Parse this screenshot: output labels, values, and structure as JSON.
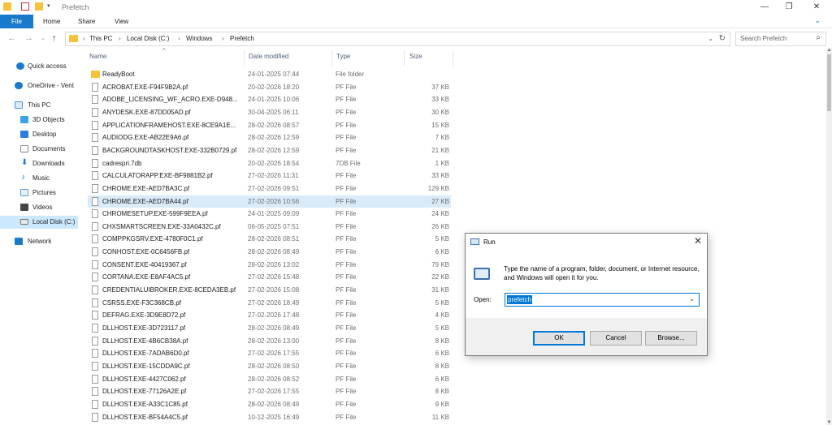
{
  "window": {
    "title": "Prefetch",
    "minimize_glyph": "—",
    "restore_glyph": "❐",
    "close_glyph": "✕"
  },
  "ribbon": {
    "tabs": [
      "File",
      "Home",
      "Share",
      "View"
    ]
  },
  "address": {
    "breadcrumbs": [
      "This PC",
      "Local Disk (C:)",
      "Windows",
      "Prefetch"
    ],
    "separator": "›"
  },
  "search": {
    "placeholder": "Search Prefetch"
  },
  "navpane": {
    "items": [
      {
        "label": "Quick access",
        "icon": "star-icon",
        "color": "#1979ca"
      },
      {
        "label": "OneDrive - Vent",
        "icon": "cloud-icon",
        "color": "#1979ca"
      },
      {
        "label": "This PC",
        "icon": "computer-icon",
        "color": "#4a90d9"
      },
      {
        "label": "3D Objects",
        "icon": "cube-icon",
        "color": "#3aa3e3"
      },
      {
        "label": "Desktop",
        "icon": "desktop-icon",
        "color": "#2b7de0"
      },
      {
        "label": "Documents",
        "icon": "documents-icon",
        "color": "#8a8a8a"
      },
      {
        "label": "Downloads",
        "icon": "download-icon",
        "color": "#1979ca"
      },
      {
        "label": "Music",
        "icon": "music-icon",
        "color": "#1979ca"
      },
      {
        "label": "Pictures",
        "icon": "pictures-icon",
        "color": "#5c9bd6"
      },
      {
        "label": "Videos",
        "icon": "videos-icon",
        "color": "#444444"
      },
      {
        "label": "Local Disk (C:)",
        "icon": "drive-icon",
        "color": "#777777"
      },
      {
        "label": "Network",
        "icon": "network-icon",
        "color": "#1979ca"
      }
    ]
  },
  "columns": {
    "name": "Name",
    "date": "Date modified",
    "type": "Type",
    "size": "Size"
  },
  "files": [
    {
      "name": "ReadyBoot",
      "date": "24-01-2025 07:44",
      "type": "File folder",
      "size": "",
      "folder": true
    },
    {
      "name": "ACROBAT.EXE-F94F9B2A.pf",
      "date": "20-02-2026 18:20",
      "type": "PF File",
      "size": "37 KB"
    },
    {
      "name": "ADOBE_LICENSING_WF_ACRO.EXE-D948...",
      "date": "24-01-2025 10:06",
      "type": "PF File",
      "size": "33 KB"
    },
    {
      "name": "ANYDESK.EXE-87DD05AD.pf",
      "date": "30-04-2025 06:11",
      "type": "PF File",
      "size": "30 KB"
    },
    {
      "name": "APPLICATIONFRAMEHOST.EXE-8CE9A1E...",
      "date": "28-02-2026 08:57",
      "type": "PF File",
      "size": "15 KB"
    },
    {
      "name": "AUDIODG.EXE-AB22E9A6.pf",
      "date": "28-02-2026 12:59",
      "type": "PF File",
      "size": "7 KB"
    },
    {
      "name": "BACKGROUNDTASKHOST.EXE-332B0729.pf",
      "date": "28-02-2026 12:59",
      "type": "PF File",
      "size": "21 KB"
    },
    {
      "name": "cadrespri.7db",
      "date": "20-02-2026 18:54",
      "type": "7DB File",
      "size": "1 KB"
    },
    {
      "name": "CALCULATORAPP.EXE-BF9881B2.pf",
      "date": "27-02-2026 11:31",
      "type": "PF File",
      "size": "33 KB"
    },
    {
      "name": "CHROME.EXE-AED7BA3C.pf",
      "date": "27-02-2026 09:51",
      "type": "PF File",
      "size": "129 KB"
    },
    {
      "name": "CHROME.EXE-AED7BA44.pf",
      "date": "27-02-2026 10:56",
      "type": "PF File",
      "size": "27 KB",
      "selected": true
    },
    {
      "name": "CHROMESETUP.EXE-599F9EEA.pf",
      "date": "24-01-2025 09:09",
      "type": "PF File",
      "size": "24 KB"
    },
    {
      "name": "CHXSMARTSCREEN.EXE-33A0432C.pf",
      "date": "06-05-2025 07:51",
      "type": "PF File",
      "size": "26 KB"
    },
    {
      "name": "COMPPKGSRV.EXE-4780F0C1.pf",
      "date": "28-02-2026 08:51",
      "type": "PF File",
      "size": "5 KB"
    },
    {
      "name": "CONHOST.EXE-0C6456FB.pf",
      "date": "28-02-2026 08:49",
      "type": "PF File",
      "size": "6 KB"
    },
    {
      "name": "CONSENT.EXE-40419367.pf",
      "date": "28-02-2026 13:02",
      "type": "PF File",
      "size": "79 KB"
    },
    {
      "name": "CORTANA.EXE-E8AF4AC5.pf",
      "date": "27-02-2026 15:48",
      "type": "PF File",
      "size": "22 KB"
    },
    {
      "name": "CREDENTIALUIBROKER.EXE-8CEDA3EB.pf",
      "date": "27-02-2026 15:08",
      "type": "PF File",
      "size": "31 KB"
    },
    {
      "name": "CSRSS.EXE-F3C368CB.pf",
      "date": "27-02-2026 18:49",
      "type": "PF File",
      "size": "5 KB"
    },
    {
      "name": "DEFRAG.EXE-3D9E8D72.pf",
      "date": "27-02-2026 17:48",
      "type": "PF File",
      "size": "4 KB"
    },
    {
      "name": "DLLHOST.EXE-3D723117.pf",
      "date": "28-02-2026 08:49",
      "type": "PF File",
      "size": "5 KB"
    },
    {
      "name": "DLLHOST.EXE-4B6CB38A.pf",
      "date": "28-02-2026 13:00",
      "type": "PF File",
      "size": "8 KB"
    },
    {
      "name": "DLLHOST.EXE-7ADAB6D0.pf",
      "date": "27-02-2026 17:55",
      "type": "PF File",
      "size": "6 KB"
    },
    {
      "name": "DLLHOST.EXE-15CDDA9C.pf",
      "date": "28-02-2026 08:50",
      "type": "PF File",
      "size": "8 KB"
    },
    {
      "name": "DLLHOST.EXE-4427C062.pf",
      "date": "28-02-2026 08:52",
      "type": "PF File",
      "size": "6 KB"
    },
    {
      "name": "DLLHOST.EXE-77126A2E.pf",
      "date": "27-02-2026 17:55",
      "type": "PF File",
      "size": "8 KB"
    },
    {
      "name": "DLLHOST.EXE-A33C1C85.pf",
      "date": "28-02-2026 08:49",
      "type": "PF File",
      "size": "9 KB"
    },
    {
      "name": "DLLHOST.EXE-BF54A4C5.pf",
      "date": "10-12-2025 16:49",
      "type": "PF File",
      "size": "11 KB"
    }
  ],
  "run_dialog": {
    "title": "Run",
    "close_glyph": "✕",
    "description": "Type the name of a program, folder, document, or Internet resource, and Windows will open it for you.",
    "open_label": "Open:",
    "input_value": "prefetch",
    "ok_label": "OK",
    "cancel_label": "Cancel",
    "browse_label": "Browse..."
  }
}
